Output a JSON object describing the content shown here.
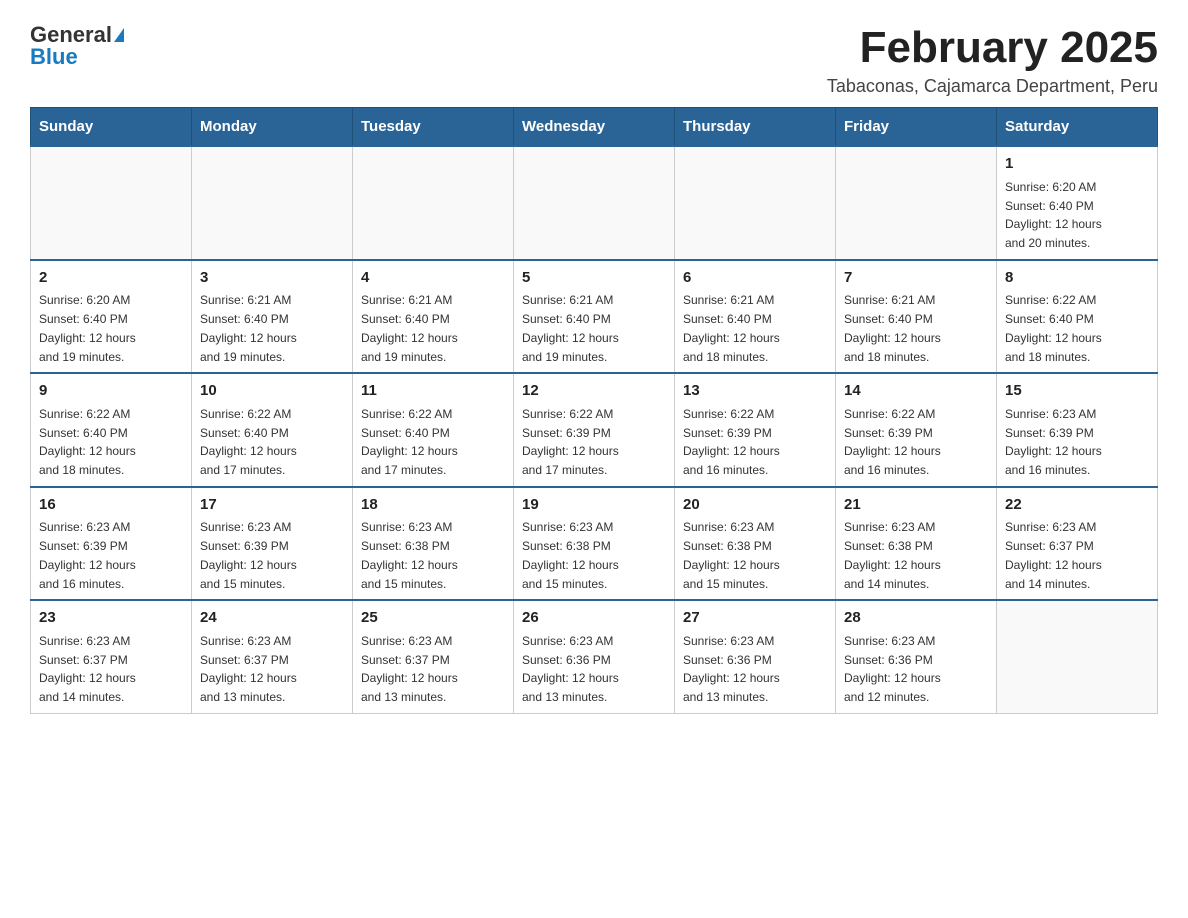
{
  "header": {
    "logo_general": "General",
    "logo_blue": "Blue",
    "month_year": "February 2025",
    "location": "Tabaconas, Cajamarca Department, Peru"
  },
  "weekdays": [
    "Sunday",
    "Monday",
    "Tuesday",
    "Wednesday",
    "Thursday",
    "Friday",
    "Saturday"
  ],
  "weeks": [
    [
      {
        "day": "",
        "info": ""
      },
      {
        "day": "",
        "info": ""
      },
      {
        "day": "",
        "info": ""
      },
      {
        "day": "",
        "info": ""
      },
      {
        "day": "",
        "info": ""
      },
      {
        "day": "",
        "info": ""
      },
      {
        "day": "1",
        "info": "Sunrise: 6:20 AM\nSunset: 6:40 PM\nDaylight: 12 hours\nand 20 minutes."
      }
    ],
    [
      {
        "day": "2",
        "info": "Sunrise: 6:20 AM\nSunset: 6:40 PM\nDaylight: 12 hours\nand 19 minutes."
      },
      {
        "day": "3",
        "info": "Sunrise: 6:21 AM\nSunset: 6:40 PM\nDaylight: 12 hours\nand 19 minutes."
      },
      {
        "day": "4",
        "info": "Sunrise: 6:21 AM\nSunset: 6:40 PM\nDaylight: 12 hours\nand 19 minutes."
      },
      {
        "day": "5",
        "info": "Sunrise: 6:21 AM\nSunset: 6:40 PM\nDaylight: 12 hours\nand 19 minutes."
      },
      {
        "day": "6",
        "info": "Sunrise: 6:21 AM\nSunset: 6:40 PM\nDaylight: 12 hours\nand 18 minutes."
      },
      {
        "day": "7",
        "info": "Sunrise: 6:21 AM\nSunset: 6:40 PM\nDaylight: 12 hours\nand 18 minutes."
      },
      {
        "day": "8",
        "info": "Sunrise: 6:22 AM\nSunset: 6:40 PM\nDaylight: 12 hours\nand 18 minutes."
      }
    ],
    [
      {
        "day": "9",
        "info": "Sunrise: 6:22 AM\nSunset: 6:40 PM\nDaylight: 12 hours\nand 18 minutes."
      },
      {
        "day": "10",
        "info": "Sunrise: 6:22 AM\nSunset: 6:40 PM\nDaylight: 12 hours\nand 17 minutes."
      },
      {
        "day": "11",
        "info": "Sunrise: 6:22 AM\nSunset: 6:40 PM\nDaylight: 12 hours\nand 17 minutes."
      },
      {
        "day": "12",
        "info": "Sunrise: 6:22 AM\nSunset: 6:39 PM\nDaylight: 12 hours\nand 17 minutes."
      },
      {
        "day": "13",
        "info": "Sunrise: 6:22 AM\nSunset: 6:39 PM\nDaylight: 12 hours\nand 16 minutes."
      },
      {
        "day": "14",
        "info": "Sunrise: 6:22 AM\nSunset: 6:39 PM\nDaylight: 12 hours\nand 16 minutes."
      },
      {
        "day": "15",
        "info": "Sunrise: 6:23 AM\nSunset: 6:39 PM\nDaylight: 12 hours\nand 16 minutes."
      }
    ],
    [
      {
        "day": "16",
        "info": "Sunrise: 6:23 AM\nSunset: 6:39 PM\nDaylight: 12 hours\nand 16 minutes."
      },
      {
        "day": "17",
        "info": "Sunrise: 6:23 AM\nSunset: 6:39 PM\nDaylight: 12 hours\nand 15 minutes."
      },
      {
        "day": "18",
        "info": "Sunrise: 6:23 AM\nSunset: 6:38 PM\nDaylight: 12 hours\nand 15 minutes."
      },
      {
        "day": "19",
        "info": "Sunrise: 6:23 AM\nSunset: 6:38 PM\nDaylight: 12 hours\nand 15 minutes."
      },
      {
        "day": "20",
        "info": "Sunrise: 6:23 AM\nSunset: 6:38 PM\nDaylight: 12 hours\nand 15 minutes."
      },
      {
        "day": "21",
        "info": "Sunrise: 6:23 AM\nSunset: 6:38 PM\nDaylight: 12 hours\nand 14 minutes."
      },
      {
        "day": "22",
        "info": "Sunrise: 6:23 AM\nSunset: 6:37 PM\nDaylight: 12 hours\nand 14 minutes."
      }
    ],
    [
      {
        "day": "23",
        "info": "Sunrise: 6:23 AM\nSunset: 6:37 PM\nDaylight: 12 hours\nand 14 minutes."
      },
      {
        "day": "24",
        "info": "Sunrise: 6:23 AM\nSunset: 6:37 PM\nDaylight: 12 hours\nand 13 minutes."
      },
      {
        "day": "25",
        "info": "Sunrise: 6:23 AM\nSunset: 6:37 PM\nDaylight: 12 hours\nand 13 minutes."
      },
      {
        "day": "26",
        "info": "Sunrise: 6:23 AM\nSunset: 6:36 PM\nDaylight: 12 hours\nand 13 minutes."
      },
      {
        "day": "27",
        "info": "Sunrise: 6:23 AM\nSunset: 6:36 PM\nDaylight: 12 hours\nand 13 minutes."
      },
      {
        "day": "28",
        "info": "Sunrise: 6:23 AM\nSunset: 6:36 PM\nDaylight: 12 hours\nand 12 minutes."
      },
      {
        "day": "",
        "info": ""
      }
    ]
  ]
}
